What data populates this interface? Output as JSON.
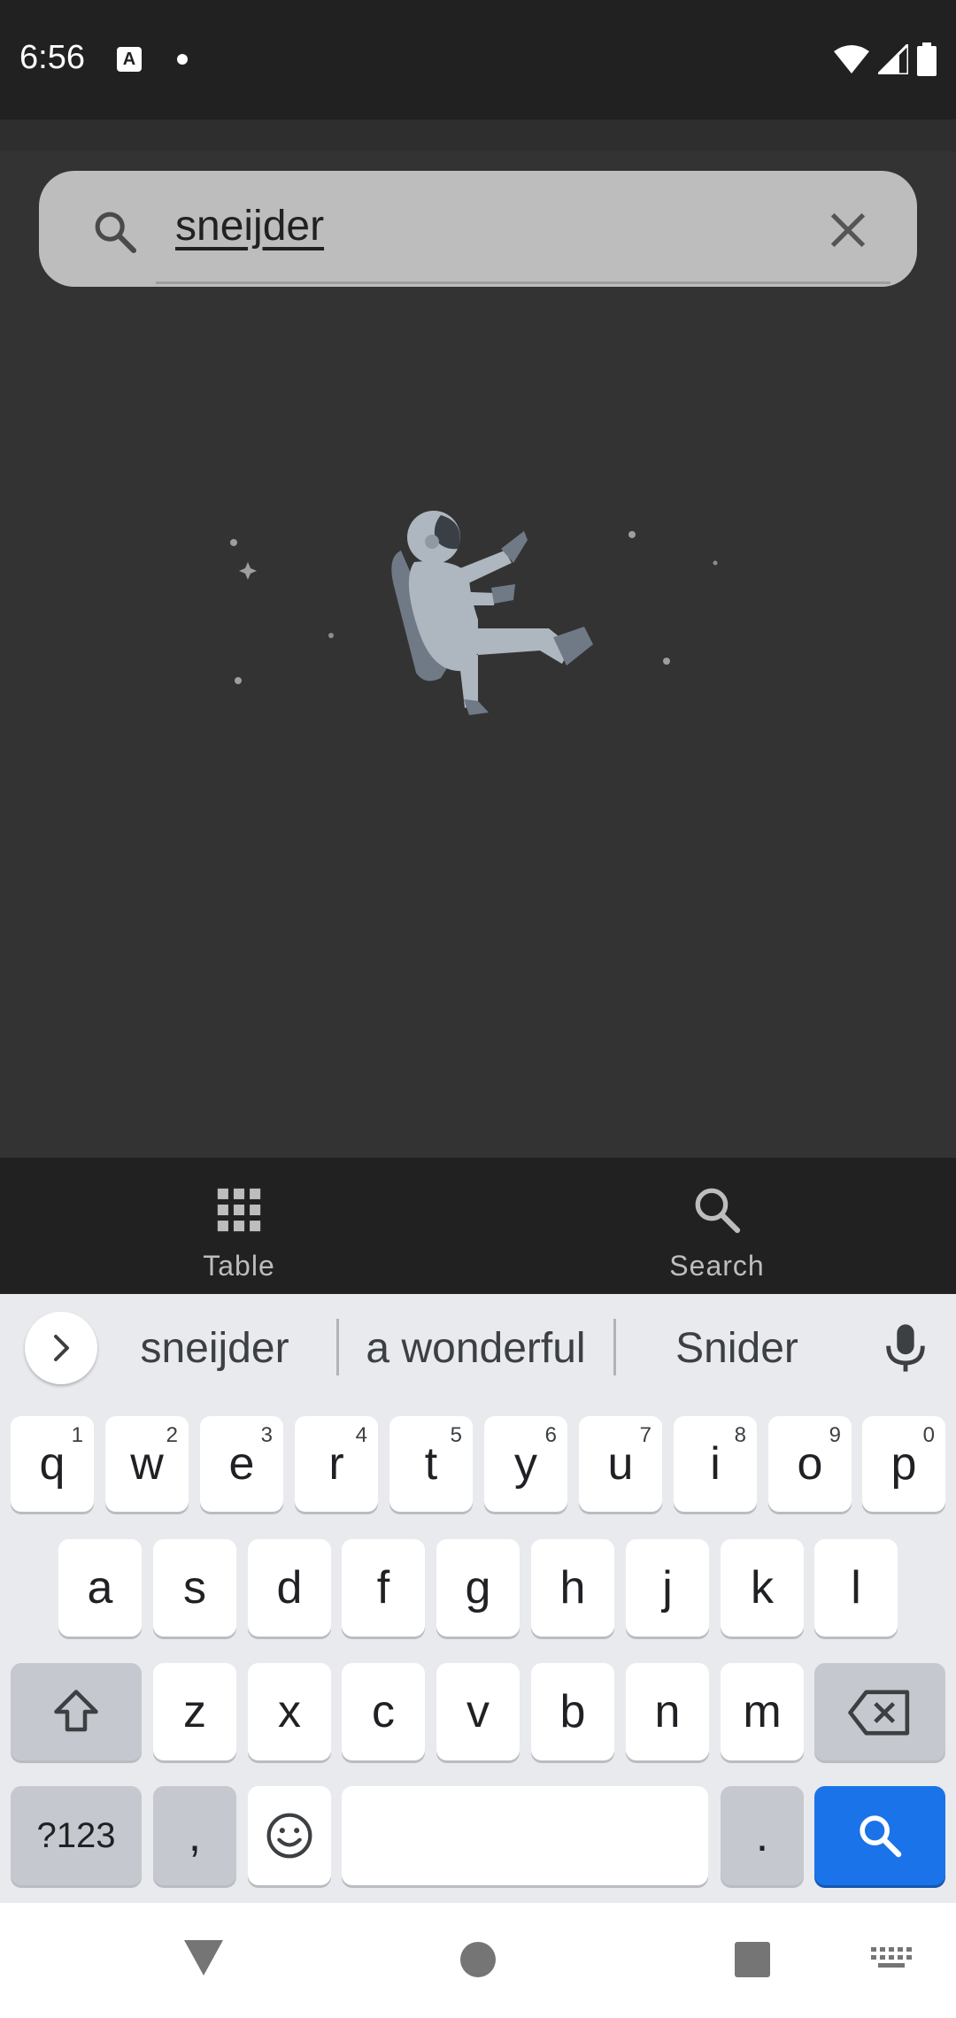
{
  "status_bar": {
    "time": "6:56",
    "app_badge": "A"
  },
  "search": {
    "query": "sneijder"
  },
  "bottom_nav": {
    "items": [
      {
        "label": "Table",
        "icon": "grid-icon"
      },
      {
        "label": "Search",
        "icon": "search-icon"
      }
    ]
  },
  "keyboard": {
    "suggestions": [
      "sneijder",
      "a wonderful",
      "Snider"
    ],
    "row1": [
      {
        "key": "q",
        "hint": "1"
      },
      {
        "key": "w",
        "hint": "2"
      },
      {
        "key": "e",
        "hint": "3"
      },
      {
        "key": "r",
        "hint": "4"
      },
      {
        "key": "t",
        "hint": "5"
      },
      {
        "key": "y",
        "hint": "6"
      },
      {
        "key": "u",
        "hint": "7"
      },
      {
        "key": "i",
        "hint": "8"
      },
      {
        "key": "o",
        "hint": "9"
      },
      {
        "key": "p",
        "hint": "0"
      }
    ],
    "row2": [
      "a",
      "s",
      "d",
      "f",
      "g",
      "h",
      "j",
      "k",
      "l"
    ],
    "row3": [
      "z",
      "x",
      "c",
      "v",
      "b",
      "n",
      "m"
    ],
    "symbols_label": "?123",
    "comma_label": ",",
    "period_label": "."
  },
  "colors": {
    "accent": "#1a73e8",
    "app_bg": "#333333",
    "nav_bg": "#212121"
  }
}
